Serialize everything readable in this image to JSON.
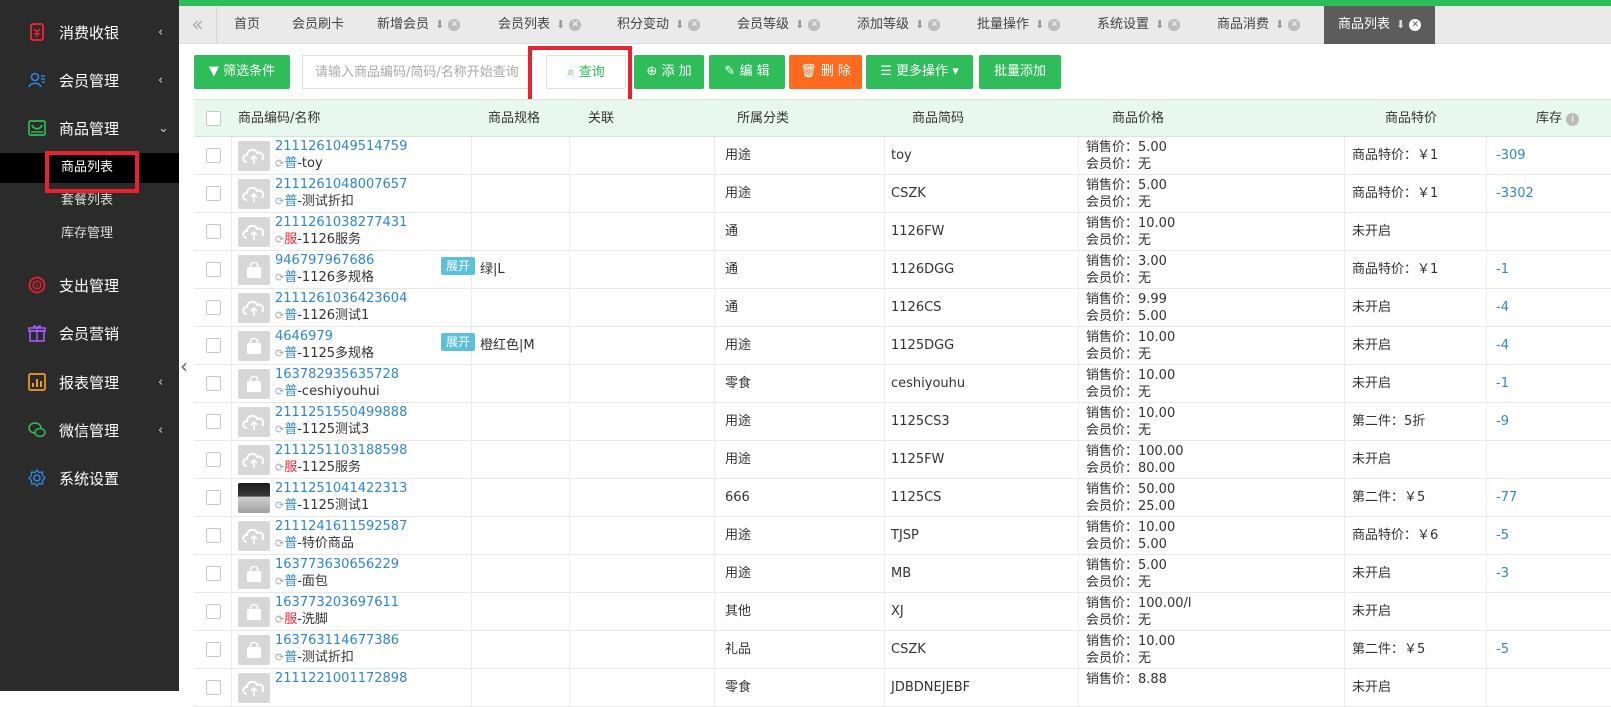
{
  "sidebar": {
    "items": [
      {
        "label": "消费收银",
        "icon": "cashier-icon",
        "color": "#e8232f",
        "caret": "‹"
      },
      {
        "label": "会员管理",
        "icon": "members-icon",
        "color": "#2f86d6",
        "caret": "‹"
      },
      {
        "label": "商品管理",
        "icon": "goods-icon",
        "color": "#2ebd59",
        "caret": "⌄"
      },
      {
        "label": "支出管理",
        "icon": "expense-icon",
        "color": "#e8232f",
        "caret": ""
      },
      {
        "label": "会员营销",
        "icon": "gift-icon",
        "color": "#a35cf0",
        "caret": ""
      },
      {
        "label": "报表管理",
        "icon": "chart-icon",
        "color": "#f0a020",
        "caret": "‹"
      },
      {
        "label": "微信管理",
        "icon": "wechat-icon",
        "color": "#2ebd59",
        "caret": "‹"
      },
      {
        "label": "系统设置",
        "icon": "settings-icon",
        "color": "#2f86d6",
        "caret": ""
      }
    ],
    "sub_items": [
      "商品列表",
      "套餐列表",
      "库存管理"
    ]
  },
  "tabs": {
    "prev": "«",
    "items": [
      {
        "label": "首页"
      },
      {
        "label": "会员刷卡"
      },
      {
        "label": "新增会员"
      },
      {
        "label": "会员列表"
      },
      {
        "label": "积分变动"
      },
      {
        "label": "会员等级"
      },
      {
        "label": "添加等级"
      },
      {
        "label": "批量操作"
      },
      {
        "label": "系统设置"
      },
      {
        "label": "商品消费"
      },
      {
        "label": "商品列表"
      }
    ]
  },
  "toolbar": {
    "filter": "筛选条件",
    "search_placeholder": "请输入商品编码/简码/名称开始查询",
    "query": "查询",
    "add": "添 加",
    "edit": "编 辑",
    "delete": "删 除",
    "more": "更多操作",
    "batch_add": "批量添加"
  },
  "table": {
    "columns": [
      "商品编码/名称",
      "商品规格",
      "关联",
      "所属分类",
      "商品简码",
      "商品价格",
      "商品特价",
      "库存"
    ],
    "expand_label": "展开",
    "rows": [
      {
        "code": "2111261049514759",
        "tag": "普",
        "name": "-toy",
        "spec": "",
        "category": "用途",
        "short": "toy",
        "sale": "销售价：5.00",
        "member": "会员价：无",
        "special": "商品特价：￥1",
        "stock": "-309",
        "thumb": "cloud"
      },
      {
        "code": "2111261048007657",
        "tag": "普",
        "name": "-测试折扣",
        "spec": "",
        "category": "用途",
        "short": "CSZK",
        "sale": "销售价：5.00",
        "member": "会员价：无",
        "special": "商品特价：￥1",
        "stock": "-3302",
        "thumb": "cloud"
      },
      {
        "code": "2111261038277431",
        "tag": "服",
        "name": "-1126服务",
        "spec": "",
        "category": "通",
        "short": "1126FW",
        "sale": "销售价：10.00",
        "member": "会员价：无",
        "special": "未开启",
        "stock": "",
        "thumb": "cloud"
      },
      {
        "code": "946797967686",
        "tag": "普",
        "name": "-1126多规格",
        "spec": "绿|L",
        "expand": true,
        "category": "通",
        "short": "1126DGG",
        "sale": "销售价：3.00",
        "member": "会员价：无",
        "special": "商品特价：￥1",
        "stock": "-1",
        "thumb": "bag"
      },
      {
        "code": "2111261036423604",
        "tag": "普",
        "name": "-1126测试1",
        "spec": "",
        "category": "通",
        "short": "1126CS",
        "sale": "销售价：9.99",
        "member": "会员价：5.00",
        "special": "未开启",
        "stock": "-4",
        "thumb": "cloud"
      },
      {
        "code": "4646979",
        "tag": "普",
        "name": "-1125多规格",
        "spec": "橙红色|M",
        "expand": true,
        "category": "用途",
        "short": "1125DGG",
        "sale": "销售价：10.00",
        "member": "会员价：无",
        "special": "未开启",
        "stock": "-4",
        "thumb": "bag"
      },
      {
        "code": "163782935635728",
        "tag": "普",
        "name": "-ceshiyouhui",
        "spec": "",
        "category": "零食",
        "short": "ceshiyouhu",
        "sale": "销售价：10.00",
        "member": "会员价：无",
        "special": "未开启",
        "stock": "-1",
        "thumb": "bag"
      },
      {
        "code": "2111251550499888",
        "tag": "普",
        "name": "-1125测试3",
        "spec": "",
        "category": "用途",
        "short": "1125CS3",
        "sale": "销售价：10.00",
        "member": "会员价：无",
        "special": "第二件：5折",
        "stock": "-9",
        "thumb": "cloud"
      },
      {
        "code": "2111251103188598",
        "tag": "服",
        "name": "-1125服务",
        "spec": "",
        "category": "用途",
        "short": "1125FW",
        "sale": "销售价：100.00",
        "member": "会员价：80.00",
        "special": "未开启",
        "stock": "",
        "thumb": "cloud"
      },
      {
        "code": "2111251041422313",
        "tag": "普",
        "name": "-1125测试1",
        "spec": "",
        "category": "666",
        "short": "1125CS",
        "sale": "销售价：50.00",
        "member": "会员价：25.00",
        "special": "第二件：￥5",
        "stock": "-77",
        "thumb": "photo"
      },
      {
        "code": "2111241611592587",
        "tag": "普",
        "name": "-特价商品",
        "spec": "",
        "category": "用途",
        "short": "TJSP",
        "sale": "销售价：10.00",
        "member": "会员价：5.00",
        "special": "商品特价：￥6",
        "stock": "-5",
        "thumb": "cloud"
      },
      {
        "code": "163773630656229",
        "tag": "普",
        "name": "-面包",
        "spec": "",
        "category": "用途",
        "short": "MB",
        "sale": "销售价：5.00",
        "member": "会员价：无",
        "special": "未开启",
        "stock": "-3",
        "thumb": "bag"
      },
      {
        "code": "163773203697611",
        "tag": "服",
        "name": "-洗脚",
        "spec": "",
        "category": "其他",
        "short": "XJ",
        "sale": "销售价：100.00/l",
        "member": "会员价：无",
        "special": "未开启",
        "stock": "",
        "thumb": "bag"
      },
      {
        "code": "163763114677386",
        "tag": "普",
        "name": "-测试折扣",
        "spec": "",
        "category": "礼品",
        "short": "CSZK",
        "sale": "销售价：10.00",
        "member": "会员价：无",
        "special": "第二件：￥5",
        "stock": "-5",
        "thumb": "bag"
      },
      {
        "code": "2111221001172898",
        "tag": "",
        "name": "",
        "spec": "",
        "category": "零食",
        "short": "JDBDNEJEBF",
        "sale": "销售价：8.88",
        "member": "",
        "special": "未开启",
        "stock": "",
        "thumb": "cloud"
      }
    ]
  }
}
